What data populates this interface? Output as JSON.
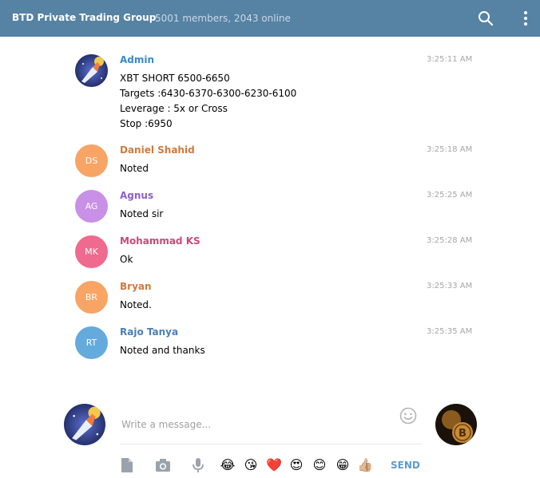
{
  "header": {
    "title": "BTD Private Trading Group",
    "subtitle": "5001 members, 2043 online",
    "search_icon": "search-icon",
    "menu_icon": "vertical-dots-icon"
  },
  "colors": {
    "header_bg": "#5682a3",
    "send": "#5d9bd0"
  },
  "messages": [
    {
      "name": "Admin",
      "initials": "",
      "name_color": "#3a8ac8",
      "avatar_color": "#2b3a7a",
      "time": "3:25:11 AM",
      "lines": [
        "XBT SHORT 6500-6650",
        "Targets :6430-6370-6300-6230-6100",
        "Leverage : 5x or Cross",
        "Stop :6950"
      ]
    },
    {
      "name": "Daniel Shahid",
      "initials": "DS",
      "name_color": "#ce7a3e",
      "avatar_color": "#f7a465",
      "time": "3:25:18 AM",
      "lines": [
        "Noted"
      ]
    },
    {
      "name": "Agnus",
      "initials": "AG",
      "name_color": "#8e5fc7",
      "avatar_color": "#c890e6",
      "time": "3:25:25 AM",
      "lines": [
        "Noted sir"
      ]
    },
    {
      "name": "Mohammad KS",
      "initials": "MK",
      "name_color": "#c94a73",
      "avatar_color": "#ef6a8e",
      "time": "3:25:28 AM",
      "lines": [
        "Ok"
      ]
    },
    {
      "name": "Bryan",
      "initials": "BR",
      "name_color": "#ce7a3e",
      "avatar_color": "#f7a465",
      "time": "3:25:33 AM",
      "lines": [
        "Noted."
      ]
    },
    {
      "name": "Rajo Tanya",
      "initials": "RT",
      "name_color": "#4a7fb8",
      "avatar_color": "#65aadd",
      "time": "3:25:35 AM",
      "lines": [
        "Noted and thanks"
      ]
    }
  ],
  "composer": {
    "placeholder": "Write a message...",
    "send_label": "SEND",
    "tools": [
      "document-icon",
      "camera-icon",
      "microphone-icon"
    ],
    "emojis": [
      "😂",
      "😘",
      "❤️",
      "😍",
      "😊",
      "😁",
      "👍🏼"
    ]
  }
}
